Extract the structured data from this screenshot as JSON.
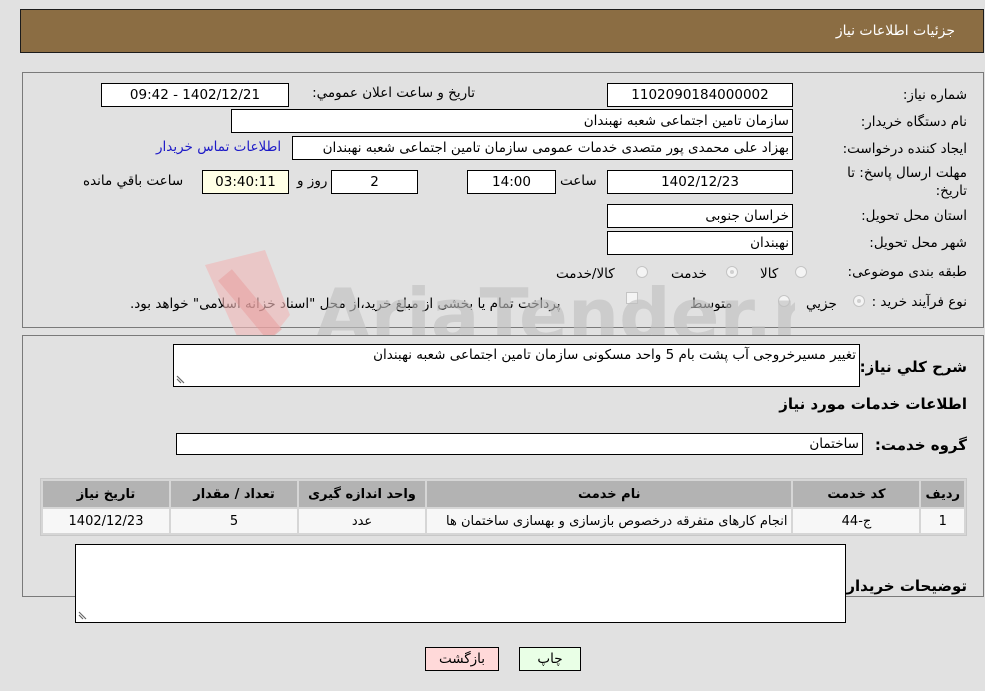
{
  "header": {
    "title": "جزئیات اطلاعات نیاز"
  },
  "fields": {
    "need_number_label": "شماره نیاز:",
    "need_number": "1102090184000002",
    "announce_label": "تاریخ و ساعت اعلان عمومي:",
    "announce_value": "1402/12/21 - 09:42",
    "buyer_org_label": "نام دستگاه خریدار:",
    "buyer_org": "سازمان تامین اجتماعی شعبه نهبندان",
    "creator_label": "ایجاد کننده درخواست:",
    "creator": "بهزاد علی محمدی پور متصدی خدمات عمومی سازمان تامین اجتماعی شعبه نهبندان",
    "contact_link": "اطلاعات تماس خریدار",
    "deadline_label_1": "مهلت ارسال پاسخ: تا",
    "deadline_label_2": "تاریخ:",
    "deadline_date": "1402/12/23",
    "time_label": "ساعت",
    "deadline_time": "14:00",
    "days_value": "2",
    "days_label": "روز و",
    "remaining_time": "03:40:11",
    "remaining_label": "ساعت باقي مانده",
    "province_label": "استان محل تحویل:",
    "province": "خراسان جنوبی",
    "city_label": "شهر محل تحویل:",
    "city": "نهبندان",
    "category_label": "طبقه بندی موضوعی:",
    "category_options": [
      {
        "label": "کالا",
        "checked": false
      },
      {
        "label": "خدمت",
        "checked": true
      },
      {
        "label": "کالا/خدمت",
        "checked": false
      }
    ],
    "process_label": "نوع فرآیند خرید :",
    "process_options": [
      {
        "label": "جزيي",
        "checked": true
      },
      {
        "label": "متوسط",
        "checked": false
      }
    ],
    "treasury_note": "پرداخت تمام یا بخشی از مبلغ خرید،از محل \"اسناد خزانه اسلامی\" خواهد بود."
  },
  "details": {
    "description_label": "شرح کلي نياز:",
    "description": "تغییر مسیرخروجی آب پشت بام 5 واحد مسکونی سازمان تامین اجتماعی شعبه نهبندان",
    "services_heading": "اطلاعات خدمات مورد نياز",
    "service_group_label": "گروه خدمت:",
    "service_group": "ساختمان",
    "table": {
      "headers": [
        "رديف",
        "کد خدمت",
        "نام خدمت",
        "واحد اندازه گیری",
        "تعداد / مقدار",
        "تاریخ نیاز"
      ],
      "rows": [
        [
          "1",
          "ج-44",
          "انجام کارهای متفرقه درخصوص بازسازی و بهسازی ساختمان ها",
          "عدد",
          "5",
          "1402/12/23"
        ]
      ]
    },
    "buyer_notes_label": "توضیحات خریدار:",
    "buyer_notes": ""
  },
  "buttons": {
    "print": "چاپ",
    "back": "بازگشت"
  },
  "watermark": {
    "text": "AriaTender.net"
  }
}
